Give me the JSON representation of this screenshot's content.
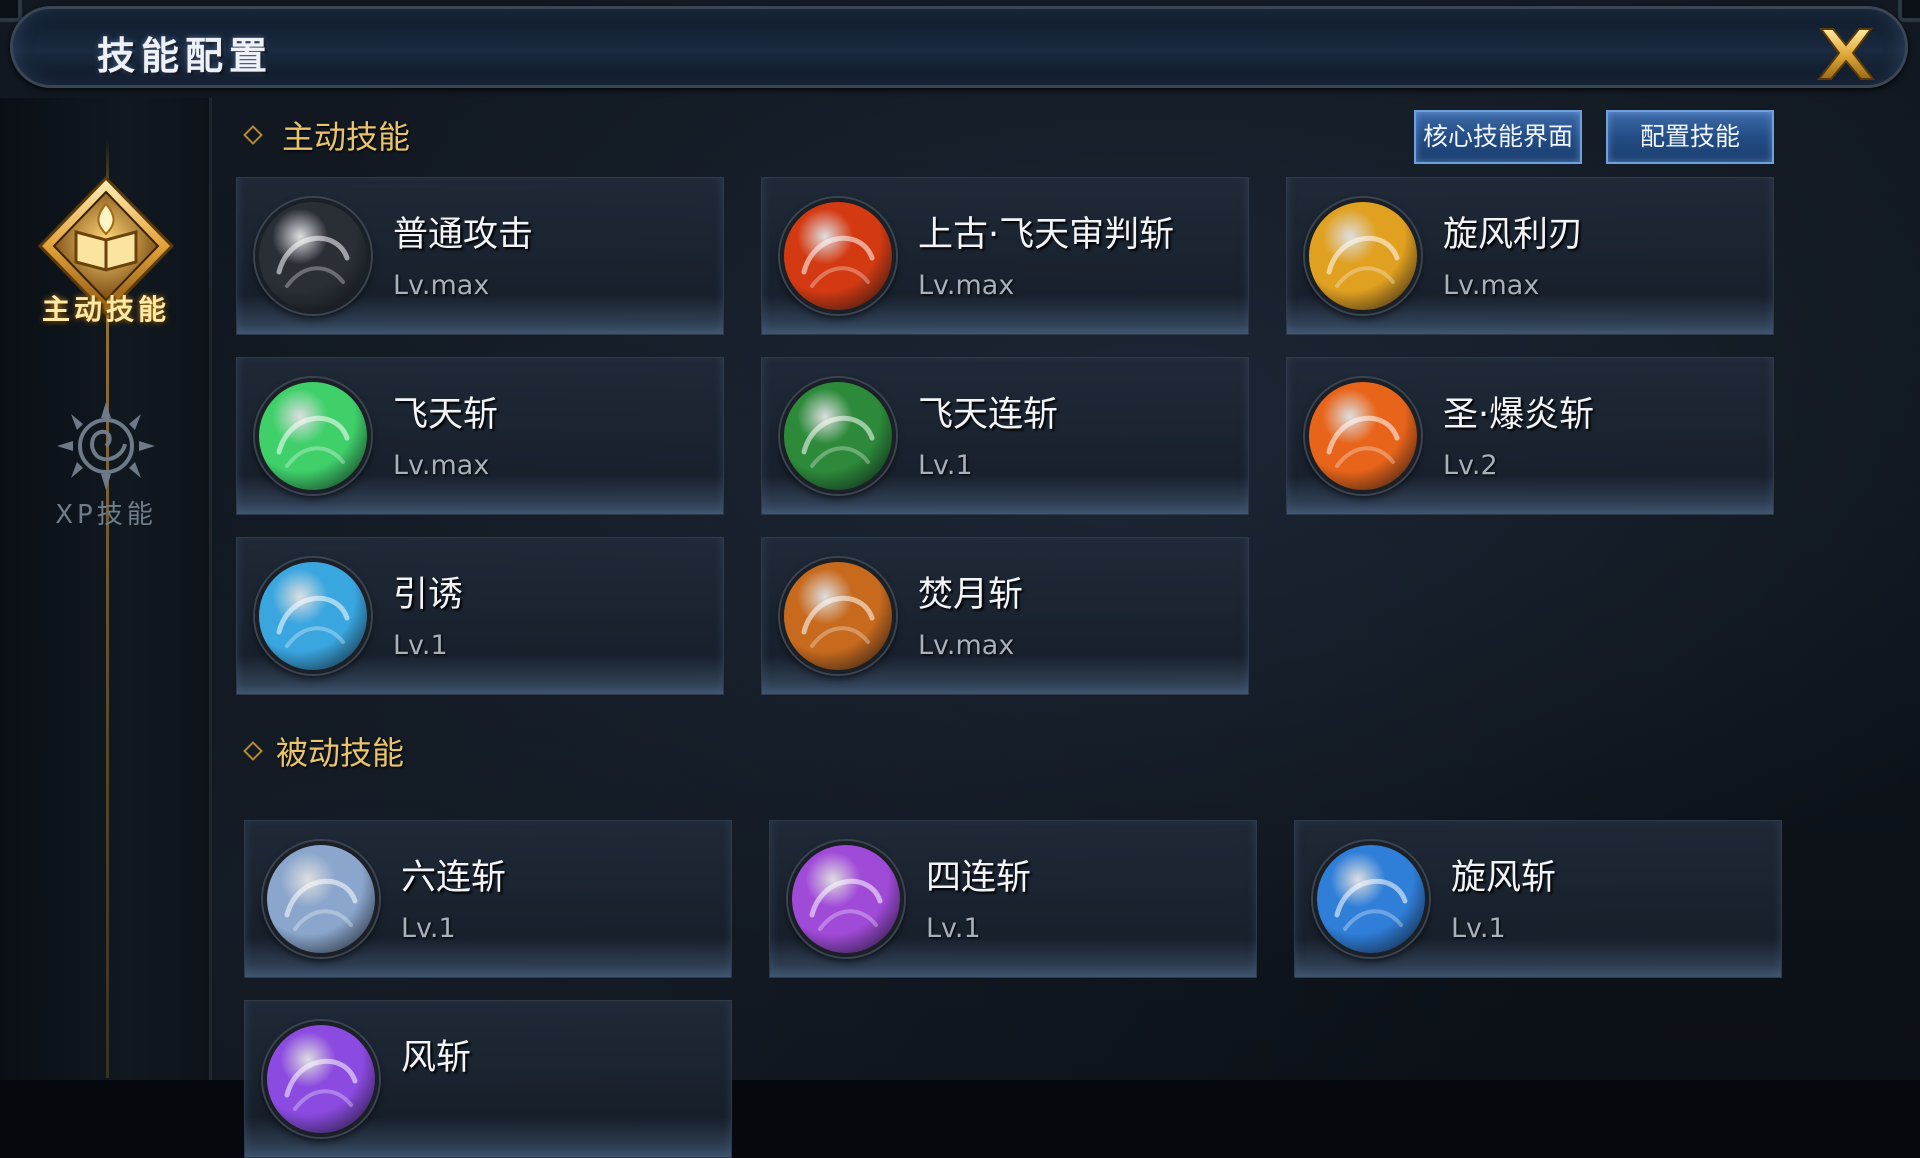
{
  "window": {
    "title": "技能配置"
  },
  "sidebar": {
    "tabs": [
      {
        "label": "主动技能",
        "active": true
      },
      {
        "label": "XP技能",
        "active": false
      }
    ]
  },
  "active_section": {
    "title": "主动技能",
    "buttons": {
      "core_label": "核心技能界面",
      "config_label": "配置技能"
    },
    "skills": [
      {
        "name": "普通攻击",
        "level": "Lv.max",
        "icon": "sword-icon",
        "color": "#2a2f36"
      },
      {
        "name": "上古·飞天审判斩",
        "level": "Lv.max",
        "icon": "fire-warrior-icon",
        "color": "#d43a12"
      },
      {
        "name": "旋风利刃",
        "level": "Lv.max",
        "icon": "golden-whirl-icon",
        "color": "#e0a020"
      },
      {
        "name": "飞天斩",
        "level": "Lv.max",
        "icon": "green-ring-icon",
        "color": "#3fd06a"
      },
      {
        "name": "飞天连斩",
        "level": "Lv.1",
        "icon": "green-hand-icon",
        "color": "#2c8a3a"
      },
      {
        "name": "圣·爆炎斩",
        "level": "Lv.2",
        "icon": "flame-slash-icon",
        "color": "#e8641a"
      },
      {
        "name": "引诱",
        "level": "Lv.1",
        "icon": "blue-vortex-icon",
        "color": "#3aa6e0"
      },
      {
        "name": "焚月斩",
        "level": "Lv.max",
        "icon": "crescent-flame-icon",
        "color": "#c86a1e"
      }
    ]
  },
  "passive_section": {
    "title": "被动技能",
    "skills": [
      {
        "name": "六连斩",
        "level": "Lv.1",
        "icon": "silver-slash-icon",
        "color": "#8aa6cc"
      },
      {
        "name": "四连斩",
        "level": "Lv.1",
        "icon": "purple-blade-icon",
        "color": "#a04ad8"
      },
      {
        "name": "旋风斩",
        "level": "Lv.1",
        "icon": "blue-cyclone-icon",
        "color": "#2f7ed8"
      },
      {
        "name": "风斩",
        "level": "",
        "icon": "violet-wind-icon",
        "color": "#8b4ae0"
      }
    ]
  }
}
